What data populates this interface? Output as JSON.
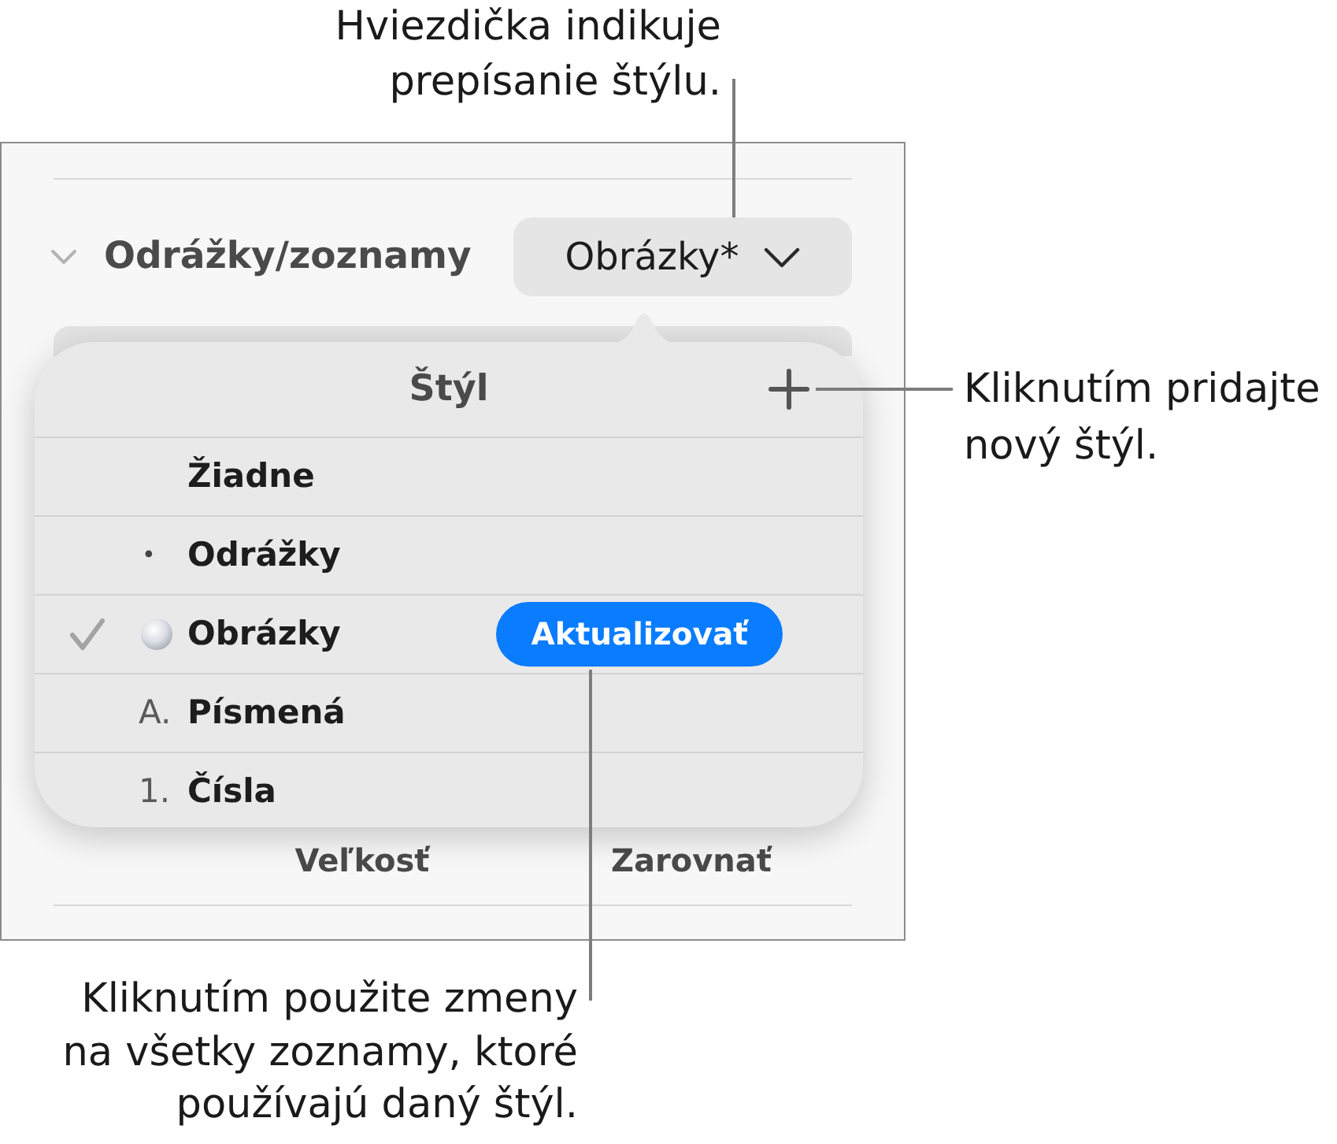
{
  "callouts": {
    "asterisk_note": "Hviezdička indikuje\nprepísanie štýlu.",
    "add_style_note": "Kliknutím pridajte\nnový štýl.",
    "update_note": "Kliknutím použite zmeny\nna všetky zoznamy, ktoré\npoužívajú daný štýl."
  },
  "panel": {
    "section": {
      "title": "Odrážky/zoznamy",
      "expanded": true
    },
    "style_button": {
      "label": "Obrázky*"
    },
    "footer_labels": [
      "Veľkosť",
      "Zarovnať"
    ]
  },
  "popover": {
    "title": "Štýl",
    "styles": [
      {
        "kind": "none",
        "label": "Žiadne",
        "selected": false
      },
      {
        "kind": "bullet",
        "marker": "•",
        "label": "Odrážky",
        "selected": false
      },
      {
        "kind": "image",
        "label": "Obrázky",
        "selected": true,
        "update_button": "Aktualizovať"
      },
      {
        "kind": "letter",
        "marker": "A.",
        "label": "Písmená",
        "selected": false
      },
      {
        "kind": "number",
        "marker": "1.",
        "label": "Čísla",
        "selected": false
      }
    ]
  }
}
